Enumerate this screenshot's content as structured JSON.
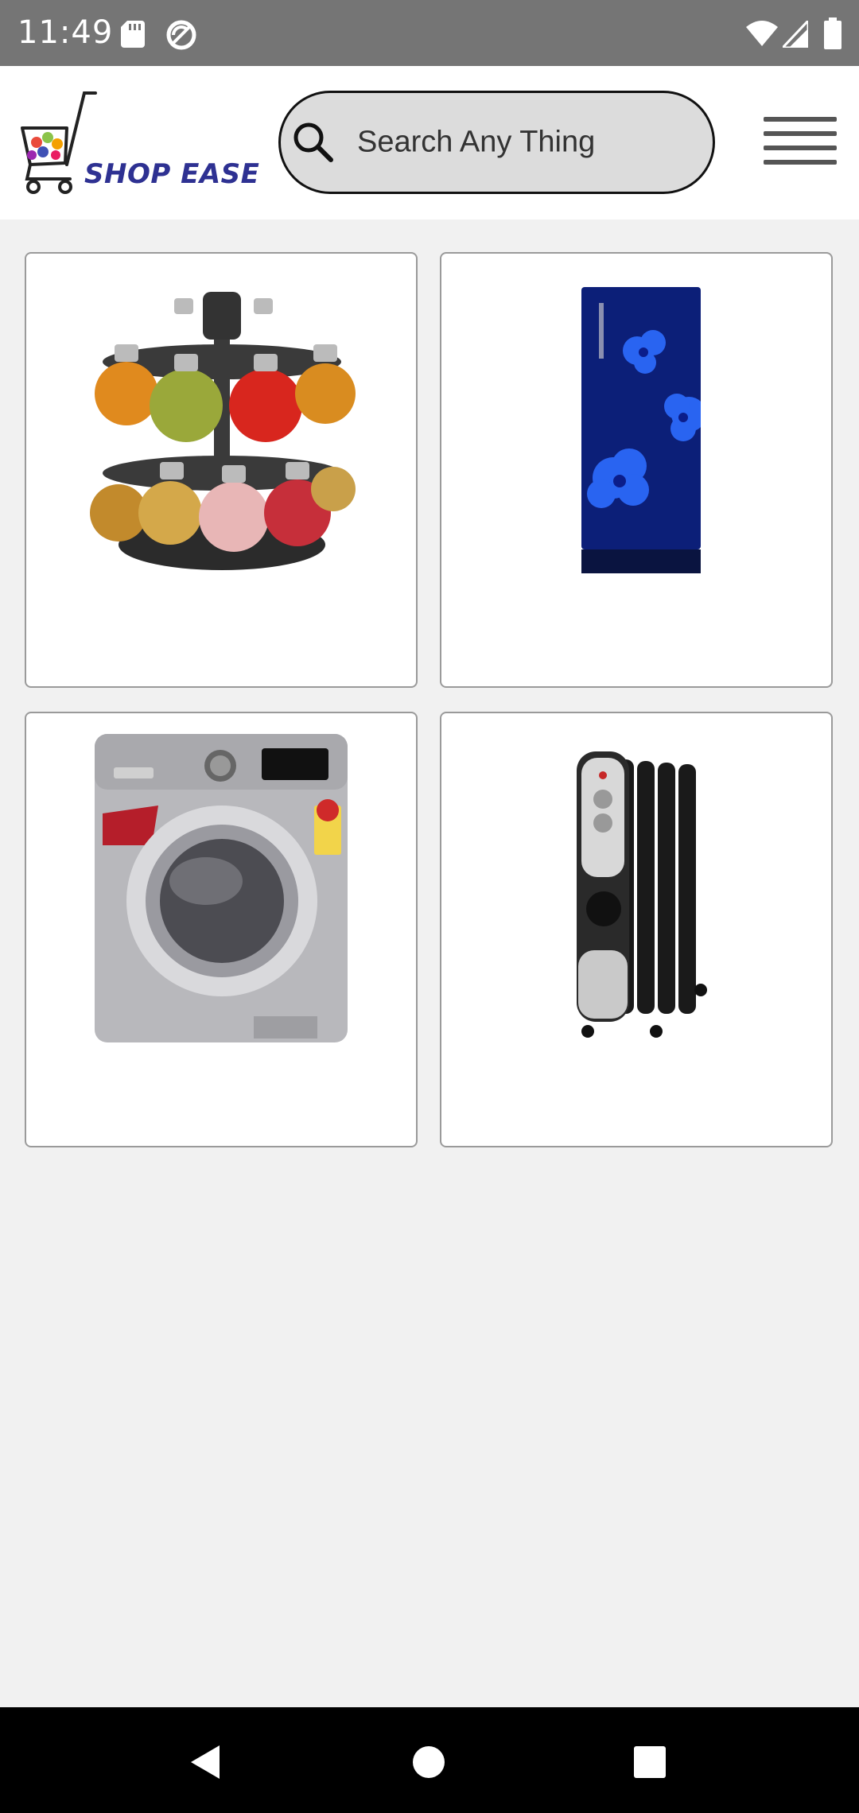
{
  "status_bar": {
    "time": "11:49",
    "left_icons": [
      "sd-card-icon",
      "sync-blocked-icon"
    ],
    "right_icons": [
      "wifi-icon",
      "cellular-signal-icon",
      "battery-icon"
    ]
  },
  "header": {
    "brand_name": "SHOP EASE",
    "brand_color": "#2e3192",
    "search": {
      "placeholder": "Search Any Thing",
      "icon": "search-icon"
    },
    "menu_icon": "hamburger-menu-icon"
  },
  "products": [
    {
      "name": "spice-rack"
    },
    {
      "name": "refrigerator"
    },
    {
      "name": "washing-machine"
    },
    {
      "name": "oil-radiator-heater"
    }
  ],
  "nav_bar": {
    "icons": [
      "back-icon",
      "home-icon",
      "recents-icon"
    ]
  }
}
